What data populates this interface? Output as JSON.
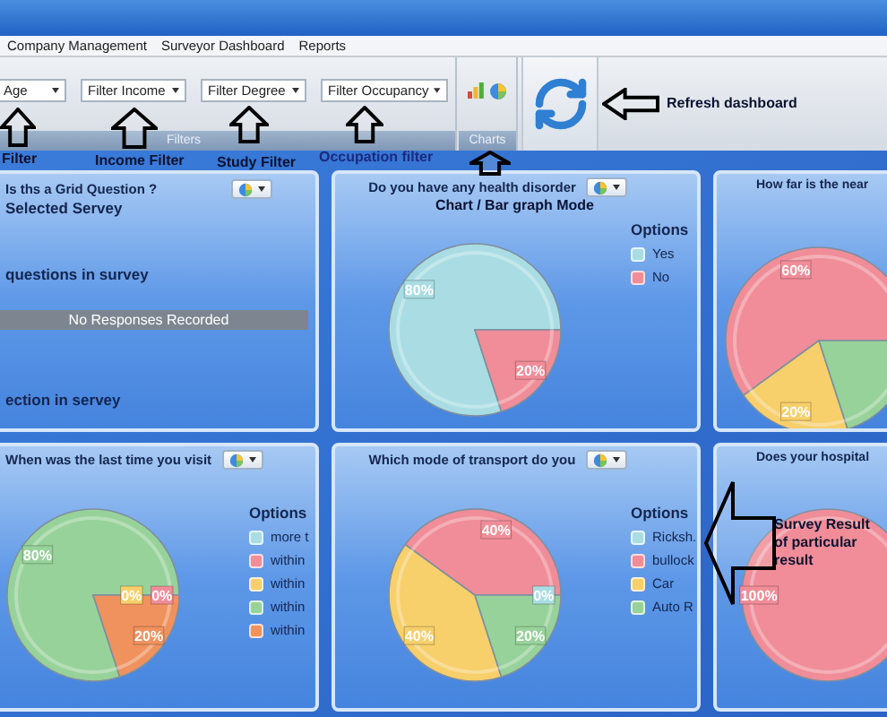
{
  "menu": [
    "Company Management",
    "Surveyor Dashboard",
    "Reports"
  ],
  "filters": [
    "Age",
    "Filter Income",
    "Filter Degree",
    "Filter Occupancy"
  ],
  "ribbon_groups": [
    "Filters",
    "Charts"
  ],
  "annotations": [
    {
      "text": "Filter",
      "kind": "up_arrow"
    },
    {
      "text": "Income Filter",
      "kind": "up_arrow"
    },
    {
      "text": "Study Filter",
      "kind": "up_arrow"
    },
    {
      "text": "Occupation filter",
      "kind": "up_arrow"
    },
    {
      "text": "Chart / Bar graph Mode",
      "kind": "up_arrow"
    },
    {
      "text": "Refresh dashboard",
      "kind": "left_arrow"
    },
    {
      "text": "Survey Result of particular result",
      "kind": "left_arrow"
    }
  ],
  "panels": [
    {
      "kind": "text",
      "title": "Is ths a Grid Question ?",
      "lines": [
        {
          "kind": "heading",
          "text": "Selected Servey"
        },
        {
          "kind": "heading",
          "text": "questions in survey"
        },
        {
          "kind": "notice",
          "text": "No Responses Recorded"
        },
        {
          "kind": "heading",
          "text": "ection in servey"
        }
      ]
    },
    {
      "kind": "pie",
      "title": "Do you have any health disorder",
      "legend_title": "Options",
      "legend": [
        {
          "label": "Yes",
          "color": "#a9dde3"
        },
        {
          "label": "No",
          "color": "#f08d98"
        }
      ],
      "chart_data": {
        "type": "pie",
        "values": [
          80,
          20
        ],
        "value_labels": [
          "80%",
          "20%"
        ]
      }
    },
    {
      "kind": "pie",
      "title": "How far is the near",
      "slices": [
        {
          "color": "#f08d98"
        },
        {
          "color": "#f7cf6b"
        },
        {
          "color": "#97d29a"
        }
      ],
      "chart_data": {
        "type": "pie",
        "values": [
          60,
          20,
          20
        ],
        "value_labels": [
          "60%",
          "20%",
          null
        ]
      }
    },
    {
      "kind": "pie",
      "title": "When was the last time you visit",
      "legend_title": "Options",
      "legend": [
        {
          "label": "more t",
          "color": "#a9dde3"
        },
        {
          "label": "within",
          "color": "#f08d98"
        },
        {
          "label": "within",
          "color": "#f7cf6b"
        },
        {
          "label": "within",
          "color": "#97d29a"
        },
        {
          "label": "within",
          "color": "#f0925e"
        }
      ],
      "chart_data": {
        "type": "pie",
        "values": [
          0,
          0,
          0,
          80,
          20
        ],
        "value_labels": [
          null,
          "0%",
          "0%",
          "80%",
          "20%"
        ]
      }
    },
    {
      "kind": "pie",
      "title": "Which mode of transport do you",
      "legend_title": "Options",
      "legend": [
        {
          "label": "Ricksh.",
          "color": "#a9dde3"
        },
        {
          "label": "bullock",
          "color": "#f08d98"
        },
        {
          "label": "Car",
          "color": "#f7cf6b"
        },
        {
          "label": "Auto R",
          "color": "#97d29a"
        }
      ],
      "chart_data": {
        "type": "pie",
        "values": [
          0,
          40,
          40,
          20
        ],
        "value_labels": [
          "0%",
          "40%",
          "40%",
          "20%"
        ]
      }
    },
    {
      "kind": "pie",
      "title": "Does your hospital",
      "slices": [
        {
          "color": "#f08d98"
        }
      ],
      "chart_data": {
        "type": "pie",
        "values": [
          100
        ],
        "value_labels": [
          "100%"
        ]
      }
    }
  ]
}
